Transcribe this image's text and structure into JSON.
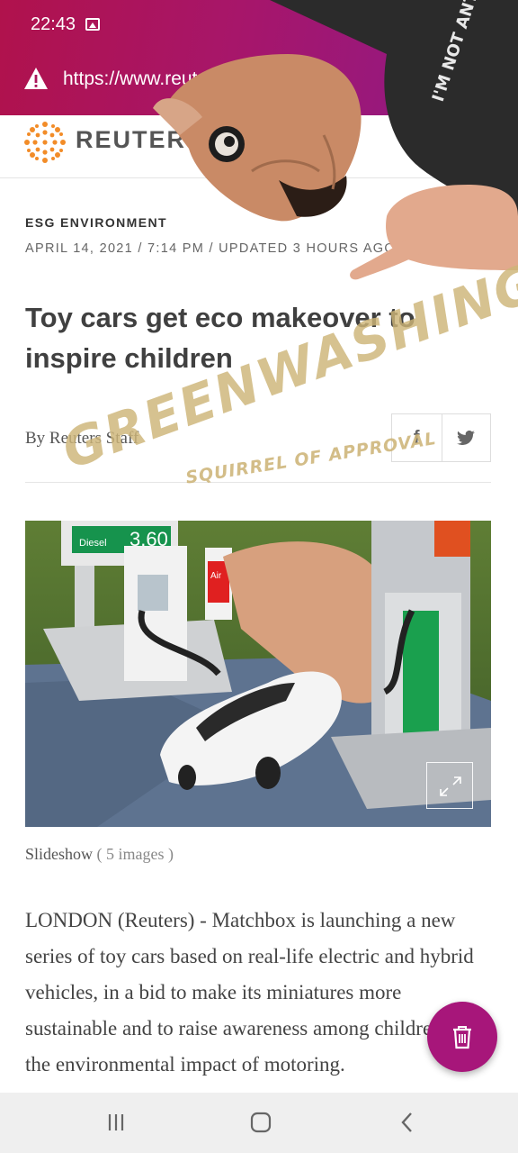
{
  "status_bar": {
    "time": "22:43",
    "notification_icon": "gallery-icon"
  },
  "url_bar": {
    "security_icon": "warning-icon",
    "url": "https://www.reuters.com"
  },
  "site": {
    "logo_text": "REUTERS"
  },
  "article": {
    "section": "ESG ENVIRONMENT",
    "dateline": "APRIL 14, 2021 / 7:14 PM / UPDATED 3 HOURS AGO",
    "headline": "Toy cars get eco makeover to inspire children",
    "byline": "By Reuters Staff",
    "share": {
      "facebook": "f",
      "twitter": "twitter-icon"
    },
    "slideshow_label": "Slideshow",
    "slideshow_count": "( 5 images )",
    "photo_signs": {
      "price": "3.60",
      "diesel": "Diesel",
      "air": "Air"
    },
    "body": "LONDON (Reuters) - Matchbox is launching a new series of toy cars based on real-life electric and hybrid vehicles, in a bid to make its miniatures more sustainable and to raise awareness among children of the environmental impact of motoring."
  },
  "overlay": {
    "stamp_main": "GREENWASHING",
    "stamp_sub": "SQUIRREL OF APPROVAL",
    "shirt_text": "I'M NOT ANTI-SOCIAL I'M ANTI-STUPID"
  },
  "fab": {
    "icon": "trash-icon"
  },
  "navbar": {
    "recents": "recents-icon",
    "home": "home-icon",
    "back": "back-icon"
  },
  "colors": {
    "topbar_start": "#b0124c",
    "topbar_end": "#8c1a8a",
    "fab": "#a7167a",
    "stamp": "#cdb478"
  }
}
